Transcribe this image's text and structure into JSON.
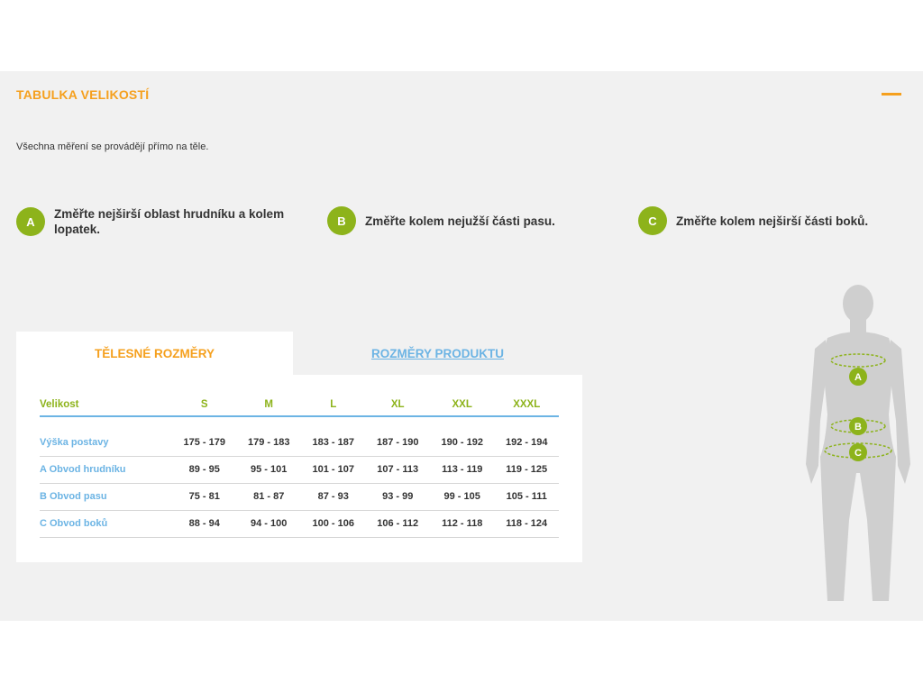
{
  "header": {
    "title": "TABULKA VELIKOSTÍ"
  },
  "intro": "Všechna měření se provádějí přímo na těle.",
  "steps": [
    {
      "letter": "A",
      "text": "Změřte nejširší oblast hrudníku a kolem lopatek."
    },
    {
      "letter": "B",
      "text": "Změřte kolem nejužší části pasu."
    },
    {
      "letter": "C",
      "text": "Změřte kolem nejširší části boků."
    }
  ],
  "tabs": [
    {
      "label": "TĚLESNÉ ROZMĚRY",
      "active": true
    },
    {
      "label": "ROZMĚRY PRODUKTU",
      "active": false
    }
  ],
  "table": {
    "headers": [
      "Velikost",
      "S",
      "M",
      "L",
      "XL",
      "XXL",
      "XXXL"
    ],
    "rows": [
      [
        "Výška postavy",
        "175 - 179",
        "179 - 183",
        "183 - 187",
        "187 - 190",
        "190 - 192",
        "192 - 194"
      ],
      [
        "A Obvod hrudníku",
        "89 - 95",
        "95 - 101",
        "101 - 107",
        "107 - 113",
        "113 - 119",
        "119 - 125"
      ],
      [
        "B Obvod pasu",
        "75 - 81",
        "81 - 87",
        "87 - 93",
        "93 - 99",
        "99 - 105",
        "105 - 111"
      ],
      [
        "C Obvod boků",
        "88 - 94",
        "94 - 100",
        "100 - 106",
        "106 - 112",
        "112 - 118",
        "118 - 124"
      ]
    ]
  },
  "figure": {
    "markers": [
      "A",
      "B",
      "C"
    ]
  },
  "colors": {
    "accent": "#f5a01e",
    "green": "#8db31b",
    "blue": "#6cb4e4",
    "panel": "#f1f1f1",
    "silhouette": "#cfcfcf"
  }
}
